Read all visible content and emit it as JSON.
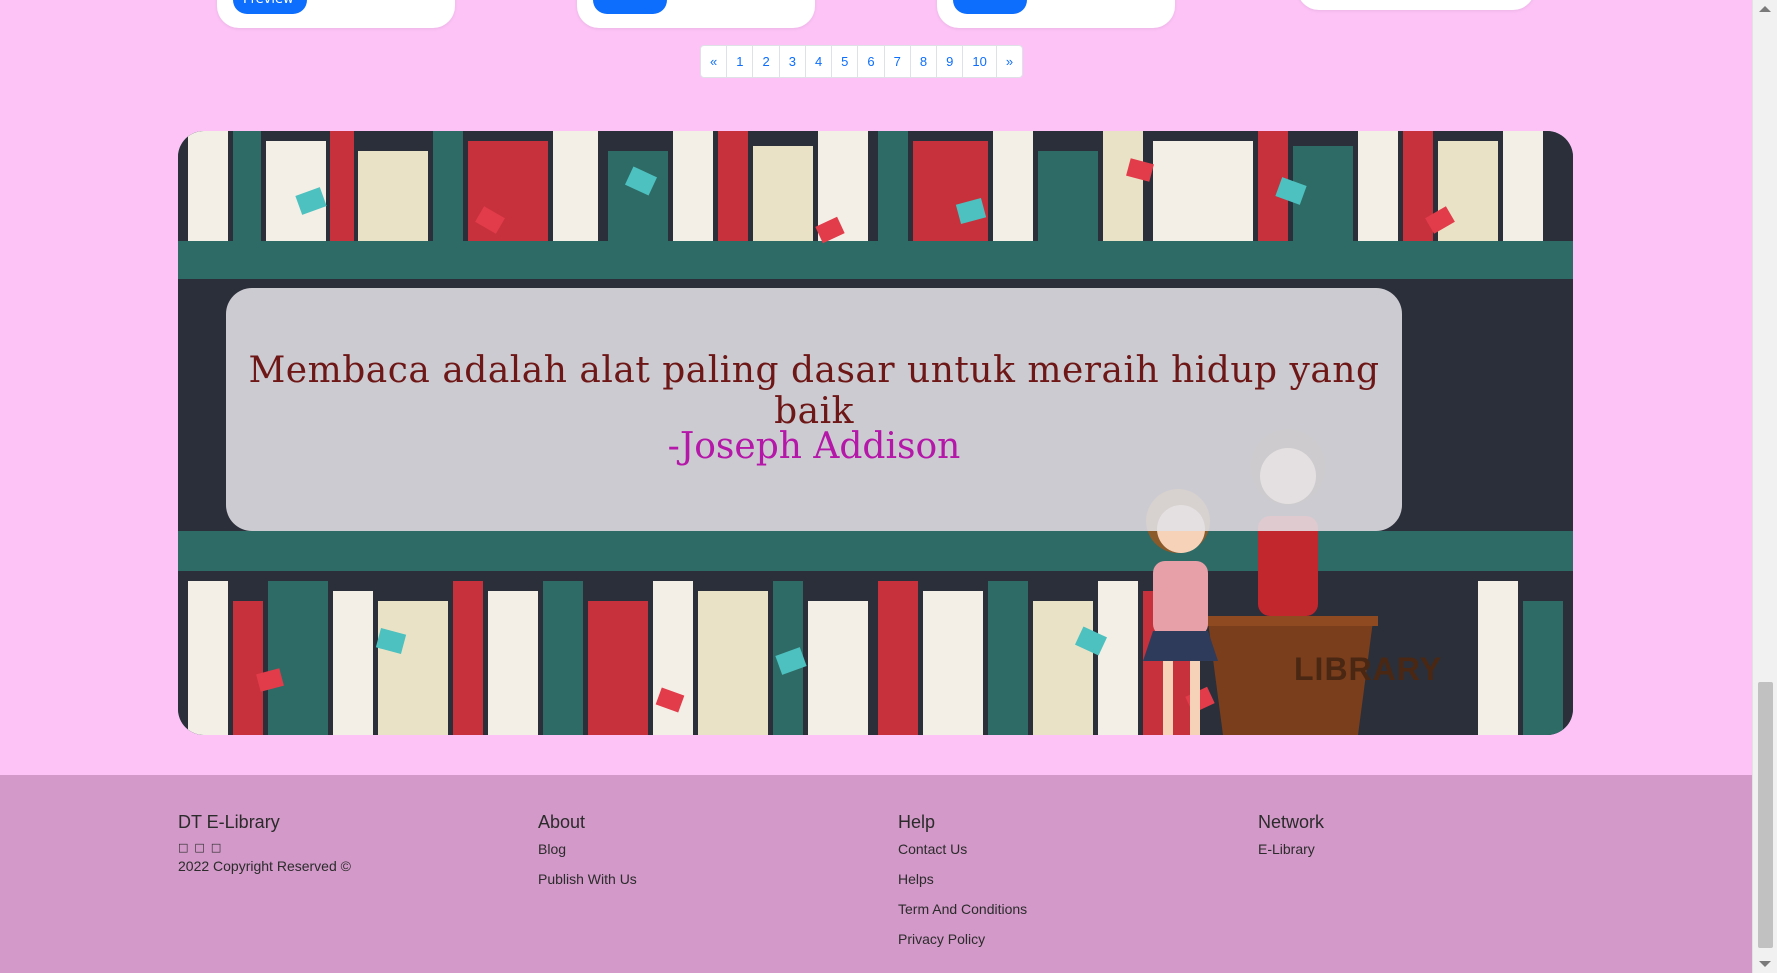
{
  "cards": [
    {
      "button_label": "Preview"
    },
    {
      "button_label": ""
    },
    {
      "button_label": ""
    },
    {
      "button_label": ""
    }
  ],
  "pagination": {
    "prev": "«",
    "pages": [
      "1",
      "2",
      "3",
      "4",
      "5",
      "6",
      "7",
      "8",
      "9",
      "10"
    ],
    "next": "»"
  },
  "banner": {
    "quote": "Membaca adalah alat paling dasar untuk meraih hidup yang baik",
    "author": "-Joseph Addison",
    "sign": "LIBRARY"
  },
  "footer": {
    "brand": {
      "title": "DT E-Library",
      "social_icons": [
        "facebook-icon",
        "twitter-icon",
        "instagram-icon"
      ],
      "copyright": "2022 Copyright Reserved ©"
    },
    "about": {
      "title": "About",
      "links": [
        "Blog",
        "Publish With Us"
      ]
    },
    "help": {
      "title": "Help",
      "links": [
        "Contact Us",
        "Helps",
        "Term And Conditions",
        "Privacy Policy"
      ]
    },
    "network": {
      "title": "Network",
      "links": [
        "E-Library"
      ]
    }
  },
  "colors": {
    "page_bg": "#fdc3f7",
    "footer_bg": "#d299c9",
    "link_blue": "#0d6efd",
    "quote_color": "#6e1717",
    "author_color": "#b517a9"
  }
}
